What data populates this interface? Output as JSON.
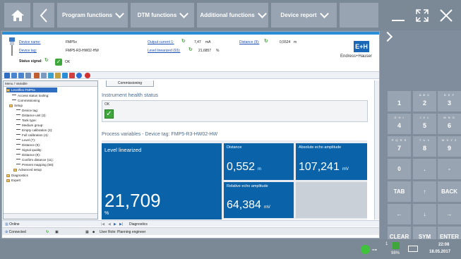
{
  "topbar": {
    "menus": [
      "Program functions",
      "DTM functions",
      "Additional functions",
      "Device report"
    ]
  },
  "header": {
    "device_name_label": "Device name:",
    "device_name_value": "FMP5x",
    "device_tag_label": "Device tag:",
    "device_tag_value": "FMP5-R3-HW02-HW",
    "status_signal_label": "Status signal:",
    "status_signal_value": "OK",
    "output_current_label": "Output current 1:",
    "output_current_value": "7,47",
    "output_current_unit": "mA",
    "level_label": "Level linearized (93):",
    "level_value": "21,6857",
    "level_unit": "%",
    "distance_label": "Distance (9):",
    "distance_value": "0,5524",
    "distance_unit": "m",
    "brand_logo": "E+H",
    "brand_name": "Endress+Hauser"
  },
  "tree": {
    "header": "Menu / Variable",
    "items": [
      "Levelflex FMP5x",
      "Access status tooling:",
      "Commissioning",
      "Setup",
      "Device tag:",
      "Distance unit (2):",
      "Tank type:",
      "Medium group:",
      "Empty calibration (3):",
      "Full calibration (4):",
      "Level (7):",
      "Distance (9):",
      "Signal quality:",
      "Distance (9):",
      "Confirm distance (11):",
      "Present mapping (58):",
      "Advanced setup",
      "Diagnostics",
      "Expert"
    ]
  },
  "content": {
    "tab_label": "Commissioning",
    "health_title": "Instrument health status",
    "health_ok": "OK",
    "pv_title": "Process variables - Device tag: FMP5-R3-HW02-HW",
    "tiles": {
      "level_label": "Level linearized",
      "level_value": "21,709",
      "level_unit": "%",
      "distance_label": "Distance",
      "distance_value": "0,552",
      "distance_unit": "m",
      "abs_echo_label": "Absolute echo amplitude",
      "abs_echo_value": "107,241",
      "abs_echo_unit": "mV",
      "rel_echo_label": "Relative echo amplitude",
      "rel_echo_value": "64,384",
      "rel_echo_unit": "mV"
    }
  },
  "status": {
    "online_tab": "Online",
    "diagnostics_tab": "Diagnostics",
    "connected": "Connected",
    "user_role": "User Role: Planning engineer"
  },
  "keypad": {
    "keys": [
      {
        "sub": "",
        "main": "1"
      },
      {
        "sub": "A B C",
        "main": "2"
      },
      {
        "sub": "D E F",
        "main": "3"
      },
      {
        "sub": "G H I",
        "main": "4"
      },
      {
        "sub": "J K L",
        "main": "5"
      },
      {
        "sub": "M N O",
        "main": "6"
      },
      {
        "sub": "P Q R S",
        "main": "7"
      },
      {
        "sub": "T U V",
        "main": "8"
      },
      {
        "sub": "W X Y Z",
        "main": "9"
      },
      {
        "sub": "",
        "main": "0"
      },
      {
        "sub": "",
        "main": "."
      },
      {
        "sub": "",
        "main": "-"
      },
      {
        "sub": "",
        "main": "TAB"
      },
      {
        "sub": "",
        "main": "↑"
      },
      {
        "sub": "",
        "main": "BACK"
      },
      {
        "sub": "",
        "main": "←"
      },
      {
        "sub": "",
        "main": "↓"
      },
      {
        "sub": "",
        "main": "→"
      },
      {
        "sub": "",
        "main": "CLEAR"
      },
      {
        "sub": "",
        "main": "SYM"
      },
      {
        "sub": "",
        "main": "ENTER"
      }
    ]
  },
  "taskbar": {
    "battery": "98%",
    "time": "22:08",
    "date": "18.05.2017",
    "badge": "1"
  },
  "colors": {
    "accent": "#0a63a8",
    "ok_green": "#3ea63a",
    "chrome": "#7b8896",
    "button": "#98a4b1"
  }
}
